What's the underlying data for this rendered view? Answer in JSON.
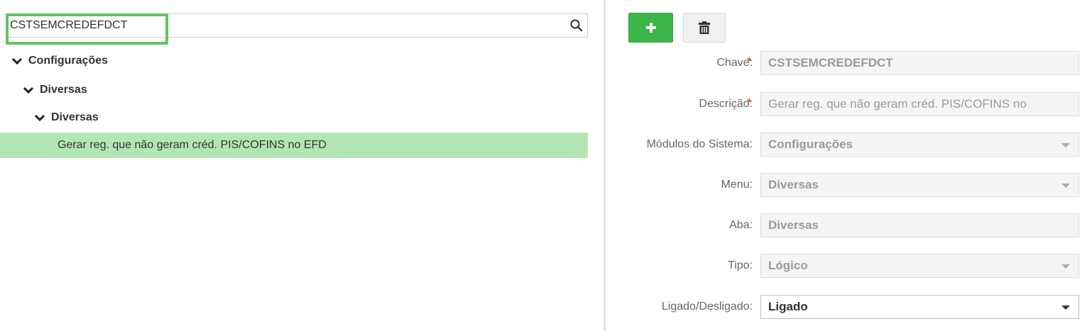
{
  "search": {
    "value": "CSTSEMCREDEFDCT",
    "icon": "search-icon"
  },
  "tree": {
    "level1": "Configurações",
    "level2": "Diversas",
    "level3": "Diversas",
    "selected_leaf": "Gerar reg. que não geram créd. PIS/COFINS no EFD"
  },
  "toolbar": {
    "add_symbol": "+",
    "add_icon": "plus-icon",
    "delete_icon": "trash-icon"
  },
  "form": {
    "required_marker": "*",
    "chave": {
      "label": "Chave:",
      "value": "CSTSEMCREDEFDCT"
    },
    "descricao": {
      "label": "Descrição:",
      "value": "Gerar reg. que não geram créd. PIS/COFINS no"
    },
    "modulos": {
      "label": "Módulos do Sistema:",
      "value": "Configurações"
    },
    "menu": {
      "label": "Menu:",
      "value": "Diversas"
    },
    "aba": {
      "label": "Aba:",
      "value": "Diversas"
    },
    "tipo": {
      "label": "Tipo:",
      "value": "Lógico"
    },
    "ligado": {
      "label": "Ligado/Desligado:",
      "value": "Ligado"
    }
  },
  "colors": {
    "accent_green": "#3cb54a",
    "selection_green": "#b3e6b5",
    "highlight_green": "#62c462",
    "required_red": "#e8502e"
  }
}
